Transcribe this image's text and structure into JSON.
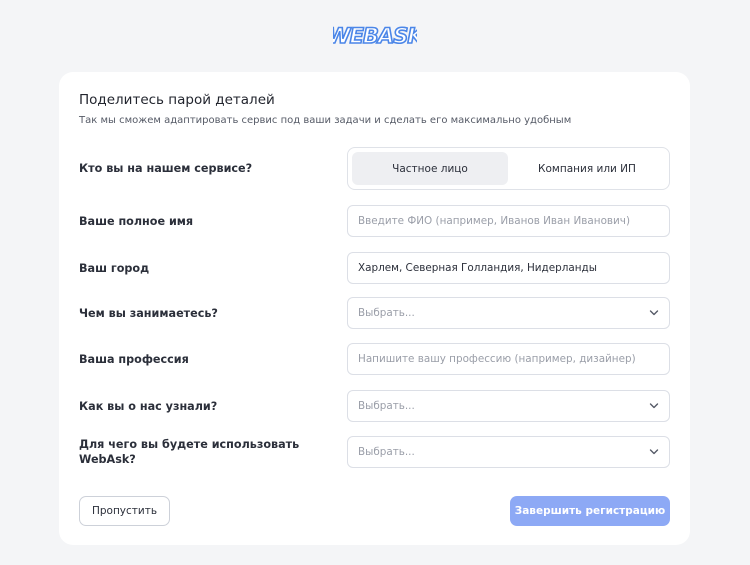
{
  "brand": {
    "logo_text": "WEBASK",
    "logo_color": "#4b86e8"
  },
  "form": {
    "title": "Поделитесь парой деталей",
    "subtitle": "Так мы сможем адаптировать сервис под ваши задачи и сделать его максимально удобным",
    "who": {
      "label": "Кто вы на нашем сервисе?",
      "options": [
        "Частное лицо",
        "Компания или ИП"
      ],
      "selected": "Частное лицо"
    },
    "full_name": {
      "label": "Ваше полное имя",
      "placeholder": "Введите ФИО (например, Иванов Иван Иванович)"
    },
    "city": {
      "label": "Ваш город",
      "value": "Харлем, Северная Голландия, Нидерланды"
    },
    "occupation": {
      "label": "Чем вы занимаетесь?",
      "placeholder": "Выбрать..."
    },
    "profession": {
      "label": "Ваша профессия",
      "placeholder": "Напишите вашу профессию (например, дизайнер)"
    },
    "source": {
      "label": "Как вы о нас узнали?",
      "placeholder": "Выбрать..."
    },
    "purpose": {
      "label_line1": "Для чего вы будете использовать",
      "label_line2": "WebAsk?",
      "placeholder": "Выбрать..."
    }
  },
  "actions": {
    "skip_label": "Пропустить",
    "finish_label": "Завершить регистрацию"
  },
  "colors": {
    "background": "#f4f5f7",
    "card": "#ffffff",
    "accent_button": "#8da9f5",
    "segment_active": "#eeeff2"
  }
}
